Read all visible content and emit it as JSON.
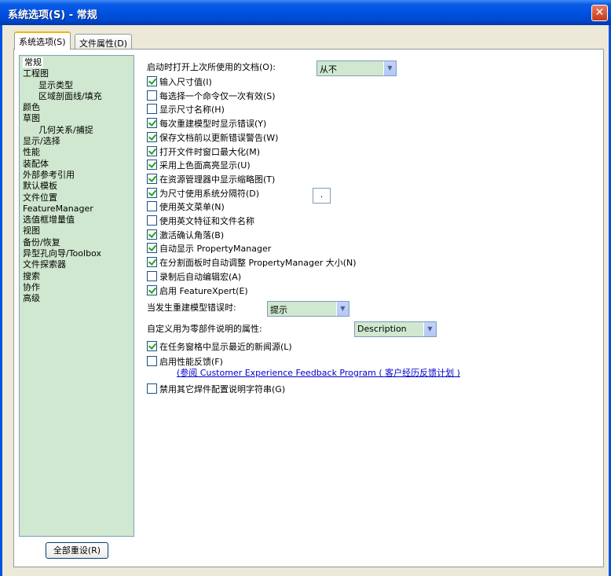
{
  "window": {
    "title": "系统选项(S) - 常规"
  },
  "tabs": [
    {
      "label": "系统选项(S)"
    },
    {
      "label": "文件属性(D)"
    }
  ],
  "tree": [
    {
      "label": "常规",
      "level": 0,
      "selected": true
    },
    {
      "label": "工程图",
      "level": 0
    },
    {
      "label": "显示类型",
      "level": 1
    },
    {
      "label": "区域剖面线/填充",
      "level": 1
    },
    {
      "label": "颜色",
      "level": 0
    },
    {
      "label": "草图",
      "level": 0
    },
    {
      "label": "几何关系/捕捉",
      "level": 1
    },
    {
      "label": "显示/选择",
      "level": 0
    },
    {
      "label": "性能",
      "level": 0
    },
    {
      "label": "装配体",
      "level": 0
    },
    {
      "label": "外部参考引用",
      "level": 0
    },
    {
      "label": "默认模板",
      "level": 0
    },
    {
      "label": "文件位置",
      "level": 0
    },
    {
      "label": "FeatureManager",
      "level": 0
    },
    {
      "label": "选值框增量值",
      "level": 0
    },
    {
      "label": "视图",
      "level": 0
    },
    {
      "label": "备份/恢复",
      "level": 0
    },
    {
      "label": "异型孔向导/Toolbox",
      "level": 0
    },
    {
      "label": "文件探索器",
      "level": 0
    },
    {
      "label": "搜索",
      "level": 0
    },
    {
      "label": "协作",
      "level": 0
    },
    {
      "label": "高级",
      "level": 0
    }
  ],
  "reset_button": "全部重设(R)",
  "open_last": {
    "label": "启动时打开上次所使用的文档(O):",
    "value": "从不"
  },
  "options": [
    {
      "label": "输入尺寸值(I)",
      "checked": true
    },
    {
      "label": "每选择一个命令仅一次有效(S)",
      "checked": false
    },
    {
      "label": "显示尺寸名称(H)",
      "checked": false
    },
    {
      "label": "每次重建模型时显示错误(Y)",
      "checked": true
    },
    {
      "label": "保存文档前以更新错误警告(W)",
      "checked": true
    },
    {
      "label": "打开文件时窗口最大化(M)",
      "checked": true
    },
    {
      "label": "采用上色面高亮显示(U)",
      "checked": true
    },
    {
      "label": "在资源管理器中显示缩略图(T)",
      "checked": true
    },
    {
      "label": "为尺寸使用系统分隔符(D)",
      "checked": true
    },
    {
      "label": "使用英文菜单(N)",
      "checked": false
    },
    {
      "label": "使用英文特征和文件名称",
      "checked": false
    },
    {
      "label": "激活确认角落(B)",
      "checked": true
    },
    {
      "label": "自动显示 PropertyManager",
      "checked": true
    },
    {
      "label": "在分割面板时自动调整 PropertyManager 大小(N)",
      "checked": true
    },
    {
      "label": "录制后自动编辑宏(A)",
      "checked": false
    },
    {
      "label": "启用 FeatureXpert(E)",
      "checked": true
    }
  ],
  "separator_value": ".",
  "rebuild_error": {
    "label": "当发生重建模型错误时:",
    "value": "提示"
  },
  "part_desc": {
    "label": "自定义用为零部件说明的属性:",
    "value": "Description"
  },
  "options2": [
    {
      "label": "在任务窗格中显示最近的新闻源(L)",
      "checked": true
    },
    {
      "label": "启用性能反馈(F)",
      "checked": false
    }
  ],
  "feedback_link": "(参阅 Customer Experience Feedback Program ( 客户经历反馈计划 )",
  "options3": [
    {
      "label": "禁用其它焊件配置说明字符串(G)",
      "checked": false
    }
  ],
  "colors": {
    "tree_bg": "#cfe8cf",
    "title_bar": "#0052e0",
    "check": "#21a121"
  }
}
